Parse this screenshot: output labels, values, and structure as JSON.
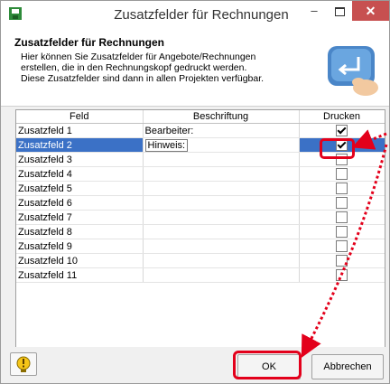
{
  "window": {
    "title": "Zusatzfelder für Rechnungen",
    "minimize_glyph": "–",
    "close_glyph": "✕"
  },
  "header": {
    "title": "Zusatzfelder für Rechnungen",
    "line1": "Hier können Sie Zusatzfelder für Angebote/Rechnungen",
    "line2": "erstellen, die in den Rechnungskopf gedruckt werden.",
    "line3": "Diese Zusatzfelder sind dann in allen Projekten verfügbar."
  },
  "table": {
    "columns": [
      "Feld",
      "Beschriftung",
      "Drucken"
    ],
    "rows": [
      {
        "feld": "Zusatzfeld 1",
        "beschriftung": "Bearbeiter:",
        "drucken": true
      },
      {
        "feld": "Zusatzfeld 2",
        "beschriftung": "Hinweis:",
        "drucken": true,
        "selected": true
      },
      {
        "feld": "Zusatzfeld 3",
        "beschriftung": "",
        "drucken": false
      },
      {
        "feld": "Zusatzfeld 4",
        "beschriftung": "",
        "drucken": false
      },
      {
        "feld": "Zusatzfeld 5",
        "beschriftung": "",
        "drucken": false
      },
      {
        "feld": "Zusatzfeld 6",
        "beschriftung": "",
        "drucken": false
      },
      {
        "feld": "Zusatzfeld 7",
        "beschriftung": "",
        "drucken": false
      },
      {
        "feld": "Zusatzfeld 8",
        "beschriftung": "",
        "drucken": false
      },
      {
        "feld": "Zusatzfeld 9",
        "beschriftung": "",
        "drucken": false
      },
      {
        "feld": "Zusatzfeld 10",
        "beschriftung": "",
        "drucken": false
      },
      {
        "feld": "Zusatzfeld 11",
        "beschriftung": "",
        "drucken": false
      }
    ]
  },
  "buttons": {
    "help_icon": "exclamation-bulb-icon",
    "ok_label": "OK",
    "cancel_label": "Abbrechen"
  },
  "colors": {
    "selection": "#3b71c6",
    "close_button": "#c75050",
    "annotation": "#e3001b"
  }
}
